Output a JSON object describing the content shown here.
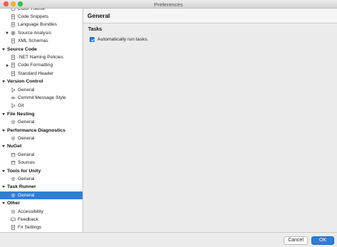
{
  "window": {
    "title": "Preferences"
  },
  "sidebar": {
    "rows": [
      {
        "kind": "item",
        "label": "Color Theme",
        "icon": "palette-icon",
        "disclosure": false,
        "selected": false
      },
      {
        "kind": "item",
        "label": "Code Snippets",
        "icon": "document-icon",
        "disclosure": false,
        "selected": false
      },
      {
        "kind": "item",
        "label": "Language Bundles",
        "icon": "document-icon",
        "disclosure": false,
        "selected": false
      },
      {
        "kind": "item",
        "label": "Source Analysis",
        "icon": "radio-icon",
        "disclosure": true,
        "selected": false
      },
      {
        "kind": "item",
        "label": "XML Schemas",
        "icon": "document-icon",
        "disclosure": false,
        "selected": false
      },
      {
        "kind": "section",
        "label": "Source Code"
      },
      {
        "kind": "item",
        "label": ".NET Naming Policies",
        "icon": "document-icon",
        "disclosure": false,
        "selected": false
      },
      {
        "kind": "item",
        "label": "Code Formatting",
        "icon": "document-icon",
        "disclosure": true,
        "selected": false
      },
      {
        "kind": "item",
        "label": "Standard Header",
        "icon": "document-icon",
        "disclosure": false,
        "selected": false
      },
      {
        "kind": "section",
        "label": "Version Control"
      },
      {
        "kind": "item",
        "label": "General",
        "icon": "branch-icon",
        "disclosure": false,
        "selected": false
      },
      {
        "kind": "item",
        "label": "Commit Message Style",
        "icon": "commit-icon",
        "disclosure": false,
        "selected": false
      },
      {
        "kind": "item",
        "label": "Git",
        "icon": "branch-icon",
        "disclosure": false,
        "selected": false
      },
      {
        "kind": "section",
        "label": "File Nesting"
      },
      {
        "kind": "item",
        "label": "General",
        "icon": "gear-icon",
        "disclosure": false,
        "selected": false
      },
      {
        "kind": "section",
        "label": "Performance Diagnostics"
      },
      {
        "kind": "item",
        "label": "General",
        "icon": "gear-icon",
        "disclosure": false,
        "selected": false
      },
      {
        "kind": "section",
        "label": "NuGet"
      },
      {
        "kind": "item",
        "label": "General",
        "icon": "package-icon",
        "disclosure": false,
        "selected": false
      },
      {
        "kind": "item",
        "label": "Sources",
        "icon": "package-icon",
        "disclosure": false,
        "selected": false
      },
      {
        "kind": "section",
        "label": "Tools for Unity"
      },
      {
        "kind": "item",
        "label": "General",
        "icon": "gear-icon",
        "disclosure": false,
        "selected": false
      },
      {
        "kind": "section",
        "label": "Task Runner"
      },
      {
        "kind": "item",
        "label": "General",
        "icon": "gear-icon",
        "disclosure": false,
        "selected": true
      },
      {
        "kind": "section",
        "label": "Other"
      },
      {
        "kind": "item",
        "label": "Accessibility",
        "icon": "gear-icon",
        "disclosure": false,
        "selected": false
      },
      {
        "kind": "item",
        "label": "Feedback",
        "icon": "feedback-icon",
        "disclosure": false,
        "selected": false
      },
      {
        "kind": "item",
        "label": "F# Settings",
        "icon": "document-icon",
        "disclosure": false,
        "selected": false
      }
    ]
  },
  "main": {
    "title": "General",
    "group_heading": "Tasks",
    "checkbox": {
      "label": "Automatically run tasks.",
      "checked": true
    }
  },
  "footer": {
    "cancel_label": "Cancel",
    "ok_label": "OK"
  },
  "colors": {
    "accent": "#2f7ed8",
    "sidebar_bg": "#ffffff",
    "window_bg": "#ececec"
  }
}
